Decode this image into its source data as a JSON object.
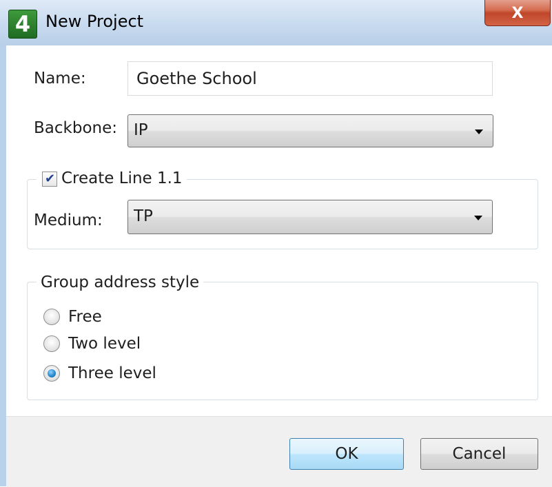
{
  "window": {
    "title": "New Project",
    "close_glyph": "X",
    "app_icon": {
      "glyph": "4",
      "name": "ets4-app-icon"
    }
  },
  "form": {
    "name_label": "Name:",
    "name_value": "Goethe School",
    "backbone_label": "Backbone:",
    "backbone_value": "IP",
    "create_line_label": "Create Line 1.1",
    "create_line_checked": true,
    "medium_label": "Medium:",
    "medium_value": "TP"
  },
  "group_address": {
    "legend": "Group address style",
    "options": [
      {
        "label": "Free",
        "selected": false
      },
      {
        "label": "Two level",
        "selected": false
      },
      {
        "label": "Three level",
        "selected": true
      }
    ]
  },
  "buttons": {
    "ok_label": "OK",
    "cancel_label": "Cancel"
  },
  "colors": {
    "title_bar": "#c7daef",
    "close_button": "#c0462a",
    "default_button_border": "#3c7fb1",
    "radio_selected": "#2a8ad0"
  }
}
